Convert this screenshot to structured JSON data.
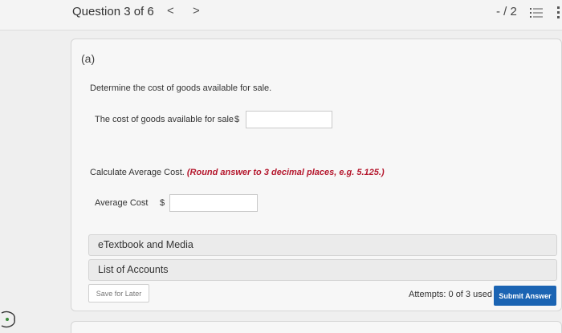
{
  "header": {
    "question_title": "Question 3 of 6",
    "prev_arrow": "<",
    "next_arrow": ">",
    "points": "- / 2",
    "list_icon": "list-icon"
  },
  "question": {
    "part_label": "(a)",
    "instruction_1": "Determine the cost of goods available for sale.",
    "field_1_label": "The cost of goods available for sale",
    "field_1_currency": "$",
    "field_1_value": "",
    "instruction_2": "Calculate Average Cost.",
    "instruction_2_note": "(Round answer to 3 decimal places, e.g. 5.125.)",
    "field_2_label": "Average Cost",
    "field_2_currency": "$",
    "field_2_value": ""
  },
  "resources": {
    "etextbook": "eTextbook and Media",
    "list_of_accounts": "List of Accounts"
  },
  "footer": {
    "save_label": "Save for Later",
    "attempts": "Attempts: 0 of 3 used",
    "submit_label": "Submit Answer"
  },
  "colors": {
    "accent": "#1b64b3",
    "note_red": "#b5182e"
  }
}
